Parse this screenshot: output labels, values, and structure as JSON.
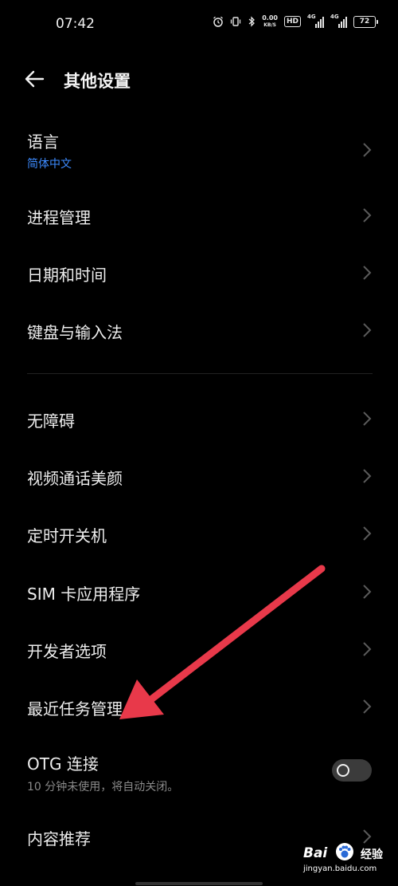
{
  "status_bar": {
    "time": "07:42",
    "speed_value": "0.00",
    "speed_unit": "KB/S",
    "hd_label": "HD",
    "sim1_label": "4G",
    "sim2_label": "4G",
    "battery": "72",
    "icons": [
      "alarm-icon",
      "vibrate-icon",
      "bluetooth-icon"
    ]
  },
  "header": {
    "back_icon": "arrow-left-icon",
    "title": "其他设置"
  },
  "items": [
    {
      "label": "语言",
      "sub": "简体中文"
    },
    {
      "label": "进程管理"
    },
    {
      "label": "日期和时间"
    },
    {
      "label": "键盘与输入法"
    },
    {
      "label": "无障碍"
    },
    {
      "label": "视频通话美颜"
    },
    {
      "label": "定时开关机"
    },
    {
      "label": "SIM 卡应用程序"
    },
    {
      "label": "开发者选项"
    },
    {
      "label": "最近任务管理"
    },
    {
      "label": "OTG 连接",
      "sub": "10 分钟未使用，将自动关闭。",
      "toggle": false
    },
    {
      "label": "内容推荐"
    }
  ],
  "watermark": {
    "brand_left": "Bai",
    "brand_right": "经验",
    "url": "jingyan.baidu.com"
  },
  "colors": {
    "background": "#000000",
    "text": "#ededed",
    "accent_blue": "#3d8bff",
    "sub_gray": "#8a8a8a",
    "arrow_red": "#e8394a"
  }
}
